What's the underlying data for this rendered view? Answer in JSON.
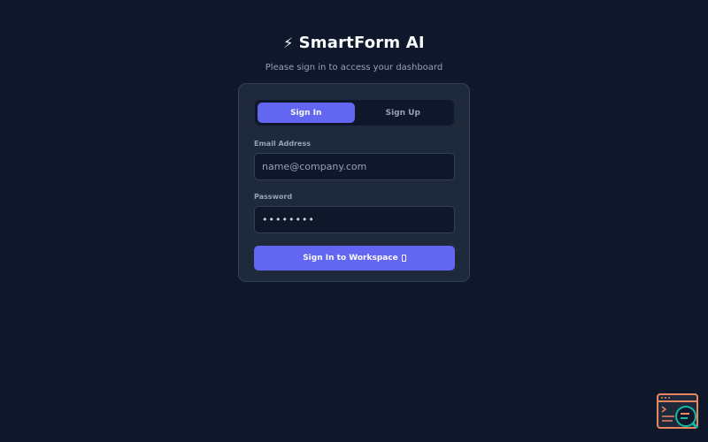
{
  "header": {
    "icon": "lightning-bolt-icon",
    "title": "SmartForm AI",
    "subtitle": "Please sign in to access your dashboard"
  },
  "auth_tabs": {
    "items": [
      {
        "label": "Sign In",
        "active": true
      },
      {
        "label": "Sign Up",
        "active": false
      }
    ]
  },
  "form": {
    "email": {
      "label": "Email Address",
      "placeholder": "name@company.com",
      "value": ""
    },
    "password": {
      "label": "Password",
      "value": "••••••••"
    },
    "submit_label": "Sign In to Workspace"
  },
  "colors": {
    "background": "#0f172a",
    "card": "#1e293b",
    "accent": "#6366f1",
    "muted_text": "#94a3b8",
    "widget_orange": "#e8875f",
    "widget_teal": "#14b8a6"
  },
  "corner_widget": {
    "icon": "code-window-search-icon"
  }
}
